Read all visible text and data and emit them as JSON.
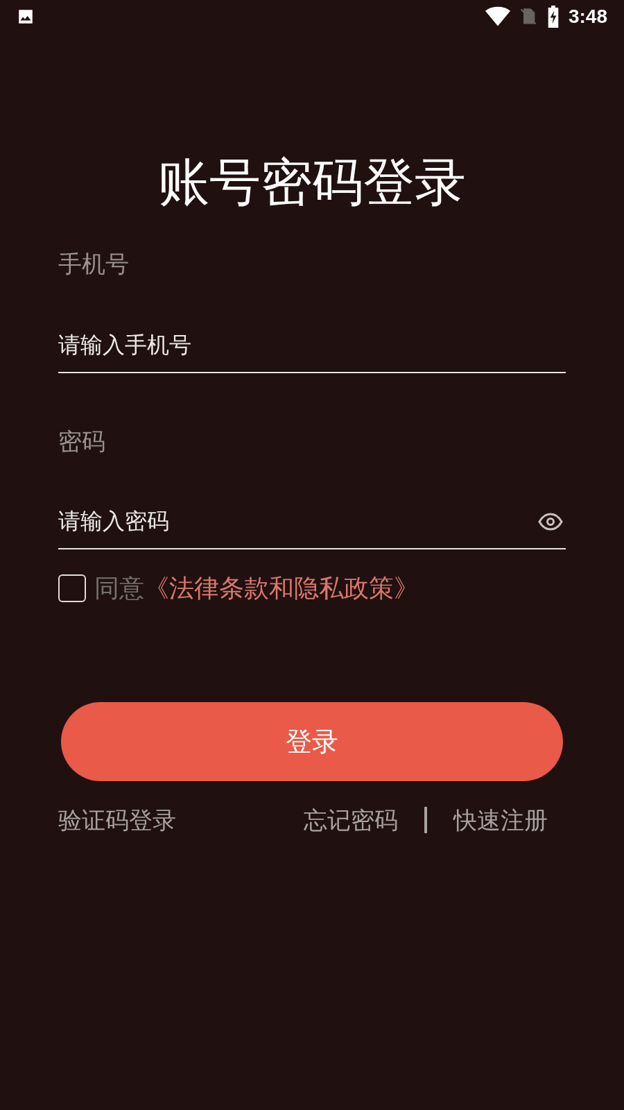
{
  "status_bar": {
    "time": "3:48"
  },
  "title": "账号密码登录",
  "phone": {
    "label": "手机号",
    "placeholder": "请输入手机号"
  },
  "password": {
    "label": "密码",
    "placeholder": "请输入密码"
  },
  "agreement": {
    "checked": false,
    "prefix": "同意",
    "link": "《法律条款和隐私政策》"
  },
  "login_button": "登录",
  "links": [
    {
      "label": "验证码登录"
    },
    {
      "label": "忘记密码"
    },
    {
      "label": "快速注册"
    }
  ]
}
